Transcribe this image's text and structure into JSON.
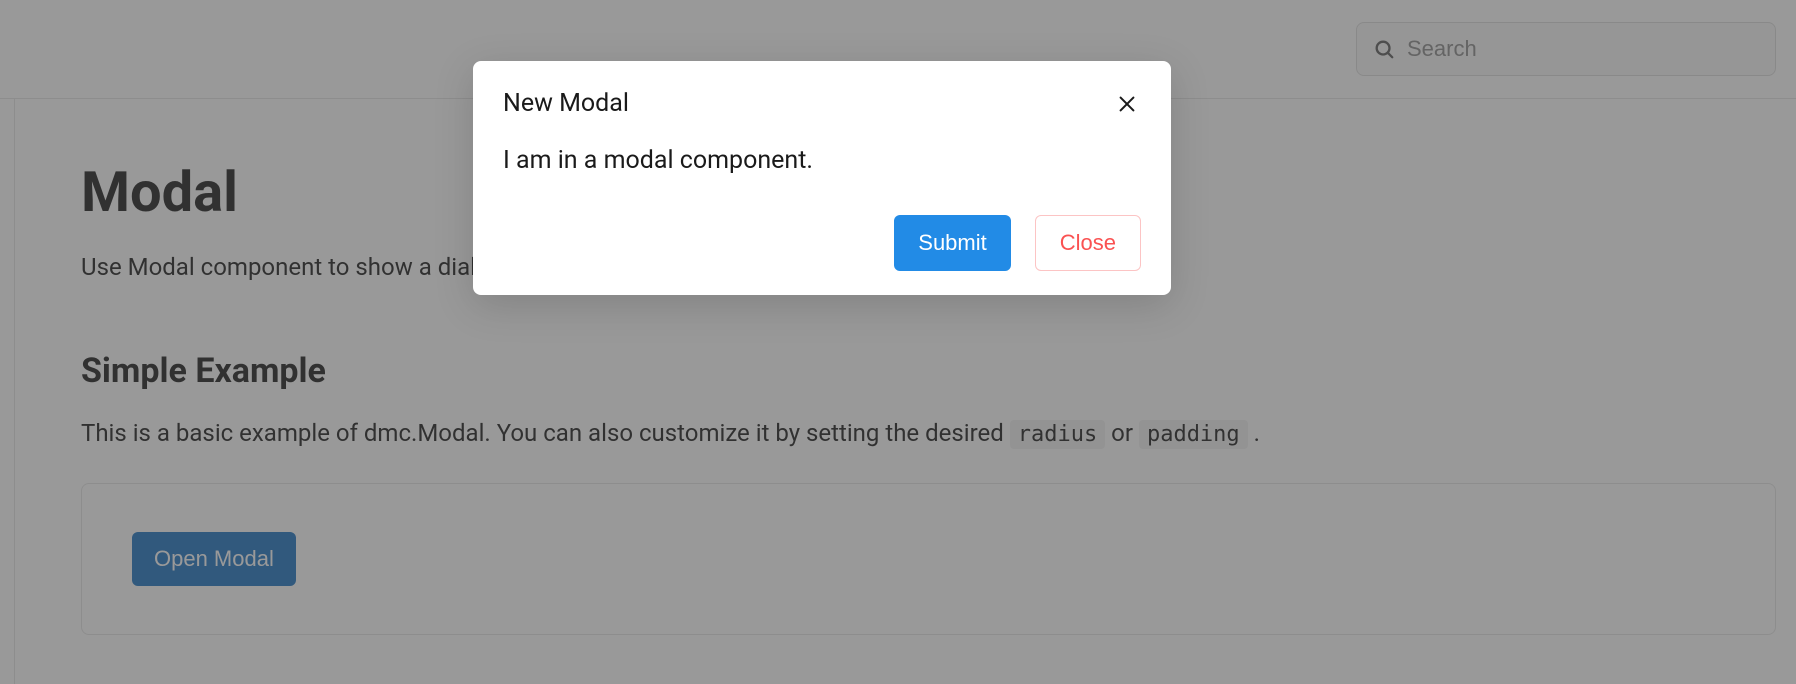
{
  "header": {
    "search_placeholder": "Search"
  },
  "page": {
    "title": "Modal",
    "description": "Use Modal component to show a dialog box or a popup window on the top of the current page.",
    "section_title": "Simple Example",
    "section_description_parts": {
      "pre": "This is a basic example of dmc.Modal. You can also customize it by setting the desired ",
      "code1": "radius",
      "mid": " or ",
      "code2": "padding",
      "post": " ."
    },
    "open_modal_label": "Open Modal"
  },
  "modal": {
    "title": "New Modal",
    "body": "I am in a modal component.",
    "submit_label": "Submit",
    "close_label": "Close"
  }
}
